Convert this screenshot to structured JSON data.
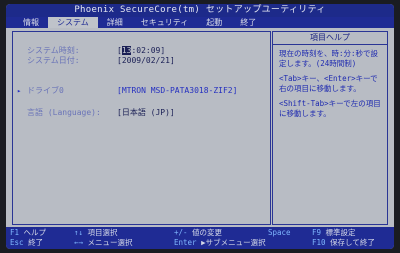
{
  "title": "Phoenix SecureCore(tm) セットアップユーティリティ",
  "menu": {
    "tabs": [
      "情報",
      "システム",
      "詳細",
      "セキュリティ",
      "起動",
      "終了"
    ],
    "active_index": 1
  },
  "main": {
    "time_label": "システム時刻:",
    "time_cursor": "13",
    "time_rest": ":02:09]",
    "time_open": "[",
    "date_label": "システム日付:",
    "date_value": "[2009/02/21]",
    "drive_label": "ドライブ0",
    "drive_value": "[MTRON MSD-PATA3018-ZIF2]",
    "lang_label": "言語 (Language):",
    "lang_value": "[日本語  (JP)]"
  },
  "help": {
    "title": "項目ヘルプ",
    "para1": "現在の時刻を、時:分:秒で設定します。(24時間制)",
    "para2": "<Tab>キー、<Enter>キーで右の項目に移動します。",
    "para3": "<Shift-Tab>キーで左の項目に移動します。"
  },
  "footer": {
    "r1": [
      {
        "key": "F1",
        "text": "ヘルプ"
      },
      {
        "key": "↑↓",
        "text": "項目選択"
      },
      {
        "key": "+/-",
        "text": "値の変更"
      },
      {
        "key": "F9",
        "text": "標準設定"
      }
    ],
    "r2": [
      {
        "key": "Esc",
        "text": "終了"
      },
      {
        "key": "←→",
        "text": "メニュー選択"
      },
      {
        "key": "Enter",
        "text": "▶サブメニュー選択"
      },
      {
        "key": "F10",
        "text": "保存して終了"
      }
    ],
    "space_key": "Space"
  }
}
